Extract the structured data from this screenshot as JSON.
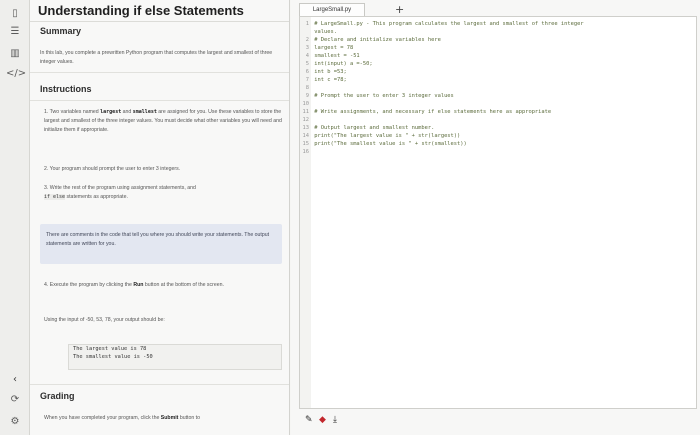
{
  "rail": {
    "icons": [
      "book-icon",
      "toc-icon",
      "chart-icon",
      "code-icon",
      "collapse-icon",
      "recycle-icon",
      "gear-icon"
    ]
  },
  "lesson": {
    "title": "Understanding if else Statements",
    "summary_heading": "Summary",
    "summary_text": "In this lab, you complete a prewritten Python program that computes the largest and smallest of three integer values.",
    "instructions_heading": "Instructions",
    "step1_prefix": "1. Two variables named ",
    "step1_var1": "largest",
    "step1_mid": " and ",
    "step1_var2": "smallest",
    "step1_rest": " are assigned for you. Use these variables to store the largest and smallest of the three integer values. You must decide what other variables you will need and initialize them if appropriate.",
    "step2": "2. Your program should prompt the user to enter 3 integers.",
    "step3_prefix": "3. Write the rest of the program using assignment statements, and",
    "step3_code": "if else",
    "step3_suffix": " statements as appropriate.",
    "callout": "There are comments in the code that tell you where you should write your statements. The output statements are written for you.",
    "step4_prefix": "4. Execute the program by clicking the ",
    "step4_bold": "Run",
    "step4_suffix": " button at the bottom of the screen.",
    "input_note": "Using the input of -50, 53, 78, your output should be:",
    "output_line1": "The largest value is 78",
    "output_line2": "The smallest value is -50",
    "grading_heading": "Grading",
    "grading_text_prefix": "When you have completed your program, click the ",
    "grading_bold": "Submit",
    "grading_text_suffix": " button to"
  },
  "editor": {
    "tab_label": "LargeSmall.py",
    "add_tab": "+",
    "lines": [
      {
        "n": "1",
        "t": "# LargeSmall.py - This program calculates the largest and smallest of three integer"
      },
      {
        "n": "",
        "t": "values."
      },
      {
        "n": "2",
        "t": "# Declare and initialize variables here"
      },
      {
        "n": "3",
        "t": "largest = 78"
      },
      {
        "n": "4",
        "t": "smallest = -51"
      },
      {
        "n": "5",
        "t": "int(input) a =-50;"
      },
      {
        "n": "6",
        "t": "int b =53;"
      },
      {
        "n": "7",
        "t": "int c =78;"
      },
      {
        "n": "8",
        "t": ""
      },
      {
        "n": "9",
        "t": "# Prompt the user to enter 3 integer values"
      },
      {
        "n": "10",
        "t": ""
      },
      {
        "n": "11",
        "t": "# Write assignments, and necessary if else statements here as appropriate"
      },
      {
        "n": "12",
        "t": ""
      },
      {
        "n": "13",
        "t": "# Output largest and smallest number."
      },
      {
        "n": "14",
        "t": "print(\"The largest value is \" + str(largest))"
      },
      {
        "n": "15",
        "t": "print(\"The smallest value is \" + str(smallest))"
      },
      {
        "n": "16",
        "t": ""
      }
    ]
  },
  "toolbar": {
    "icons": [
      "pencil-icon",
      "run-icon",
      "download-icon"
    ]
  }
}
